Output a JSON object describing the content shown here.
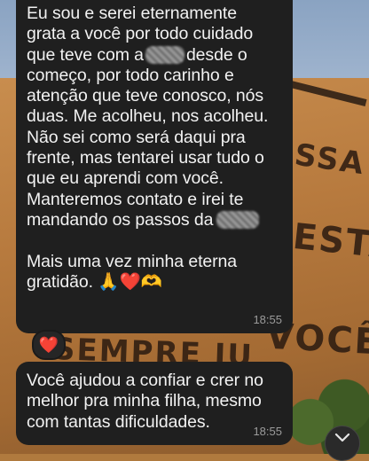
{
  "wallpaper": {
    "wall_text": [
      "SSA",
      "ESTÁ",
      "SEMPRE JU",
      "VOCÊ"
    ]
  },
  "messages": [
    {
      "lines": [
        "Eu sou e serei eternamente",
        "grata a você por todo cuidado",
        "que teve com a",
        "desde o",
        "começo, por todo carinho e",
        "atenção que teve conosco, nós",
        "duas. Me acolheu, nos acolheu.",
        "Não sei como será daqui pra",
        "frente, mas tentarei usar tudo o",
        "que eu aprendi com você.",
        "Manteremos contato e irei te",
        "mandando os passos da",
        "Mais uma vez minha eterna",
        "gratidão."
      ],
      "emojis": [
        "🙏",
        "❤️",
        "🫶"
      ],
      "time": "18:55",
      "reaction": "❤️"
    },
    {
      "lines": [
        "Você ajudou a confiar e crer no",
        "melhor pra minha filha, mesmo",
        "com tantas dificuldades."
      ],
      "time": "18:55"
    }
  ],
  "colors": {
    "bubble": "#1f1f1f",
    "text": "#f2f2f2",
    "timestamp": "#9b9b9b",
    "heart": "#e4252b"
  }
}
